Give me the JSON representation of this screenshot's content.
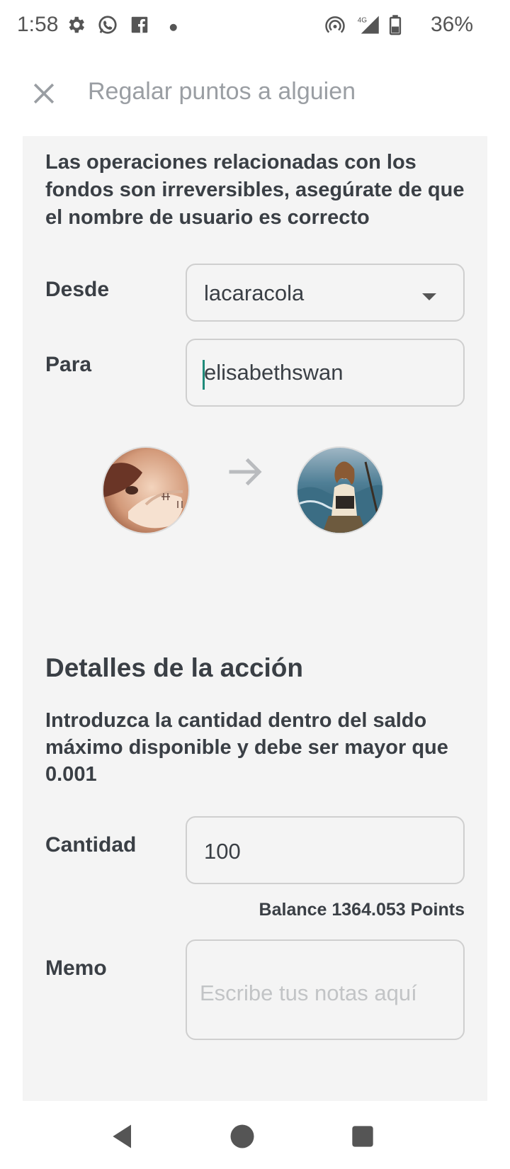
{
  "status_bar": {
    "time": "1:58",
    "battery": "36%",
    "icons": [
      "gear-icon",
      "whatsapp-icon",
      "facebook-icon",
      "dot-icon",
      "hotspot-icon",
      "signal-4g-icon",
      "battery-icon"
    ],
    "network_label": "4G"
  },
  "header": {
    "title": "Regalar puntos a alguien",
    "close_icon": "close-icon"
  },
  "transfer": {
    "warning": "Las operaciones relacionadas con los fondos son irreversibles, asegúrate de que el nombre de usuario es correcto",
    "from_label": "Desde",
    "from_value": "lacaracola",
    "to_label": "Para",
    "to_value": "elisabethswan"
  },
  "details": {
    "title": "Detalles de la acción",
    "info": "Introduzca la cantidad dentro del saldo máximo disponible  y debe ser mayor que 0.001",
    "amount_label": "Cantidad",
    "amount_value": "100",
    "balance": "Balance 1364.053 Points",
    "memo_label": "Memo",
    "memo_placeholder": "Escribe tus notas aquí"
  },
  "colors": {
    "card_bg": "#f4f4f4",
    "text": "#3a3f45",
    "muted": "#9a9ea3",
    "caret": "#1f8a7a"
  }
}
